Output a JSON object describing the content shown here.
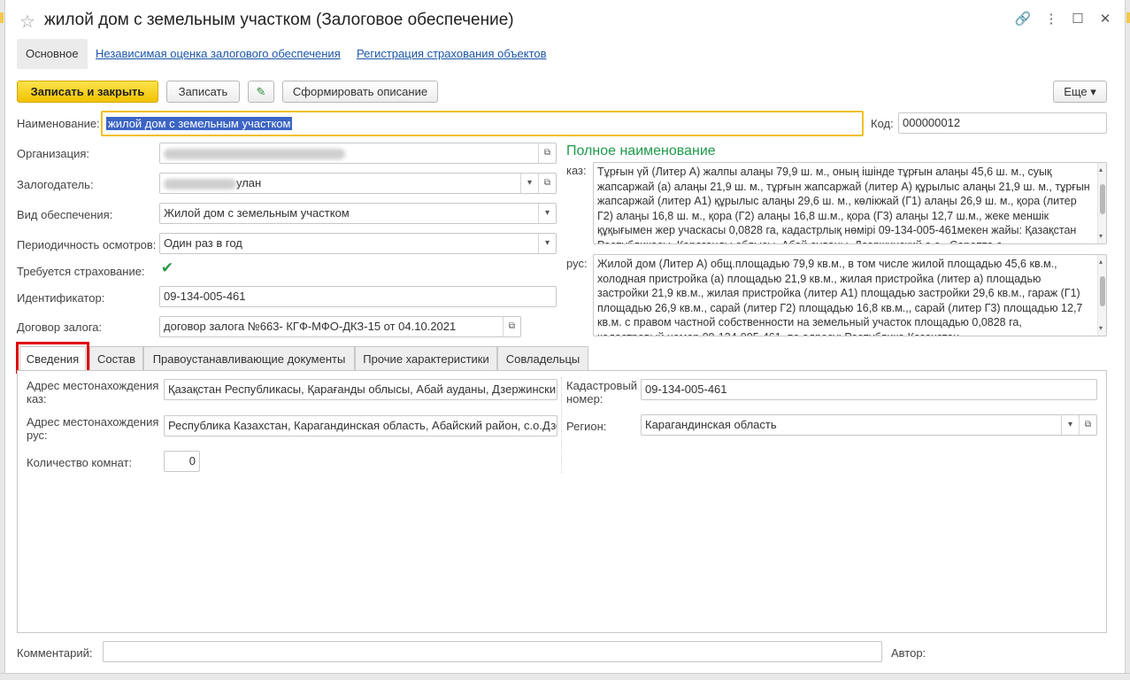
{
  "window": {
    "title": "жилой дом с земельным участком (Залоговое обеспечение)",
    "star": "☆",
    "link_icon": "🔗",
    "more_icon": "⋮",
    "maximize_icon": "☐",
    "close_icon": "✕"
  },
  "nav": {
    "main": "Основное",
    "appraisal": "Независимая оценка залогового обеспечения",
    "insurance": "Регистрация страхования объектов"
  },
  "toolbar": {
    "save_close": "Записать и закрыть",
    "save": "Записать",
    "edit_icon": "✎",
    "generate": "Сформировать описание",
    "more": "Еще ▾"
  },
  "form": {
    "name_label": "Наименование:",
    "name_value": "жилой дом с земельным участком",
    "code_label": "Код:",
    "code_value": "000000012",
    "org_label": "Организация:",
    "pledger_label": "Залогодатель:",
    "pledger_suffix": "улан",
    "type_label": "Вид обеспечения:",
    "type_value": "Жилой дом с земельным участком",
    "period_label": "Периодичность осмотров:",
    "period_value": "Один раз в год",
    "insurance_label": "Требуется страхование:",
    "insurance_check": "✔",
    "id_label": "Идентификатор:",
    "id_value": "09-134-005-461",
    "contract_label": "Договор залога:",
    "contract_value": "договор залога №663- КГФ-МФО-ДКЗ-15  от 04.10.2021"
  },
  "full_name": {
    "title": "Полное наименование",
    "kaz_label": "каз:",
    "kaz_text": "Тұрғын үй (Литер А) жалпы алаңы 79,9 ш. м., оның ішінде тұрғын алаңы 45,6 ш. м., суық жапсаржай (а) алаңы 21,9 ш. м., тұрғын жапсаржай (литер А) құрылыс алаңы 21,9 ш. м., тұрғын жапсаржай (литер А1) құрылыс алаңы 29,6 ш. м., көлікжай (Г1) алаңы 26,9 ш. м., қора (литер Г2) алаңы 16,8 ш. м., қора (Г2) алаңы 16,8 ш.м., қора (Г3) алаңы 12,7 ш.м., жеке меншік құқығымен жер учаскасы 0,0828 га,  кадастрлық нөмірі 09-134-005-461мекен жайы: Қазақстан Республикасы, Қарағанды облысы, Абай ауданы, Дзержинский а.о., Сарепта а.",
    "rus_label": "рус:",
    "rus_text": "Жилой дом (Литер А) общ.площадью 79,9 кв.м., в том числе жилой площадью 45,6 кв.м., холодная пристройка (а)  площадью 21,9 кв.м., жилая пристройка (литер а) площадью застройки 21,9 кв.м., жилая пристройка (литер А1) площадью застройки 29,6 кв.м., гараж (Г1) площадью  26,9 кв.м., сарай (литер Г2)  площадью 16,8 кв.м.,, сарай (литер Г3) площадью 12,7 кв.м. с правом частной собственности на земельный участок площадью 0,0828 га, кадастровый номер 09-134-005-461, по адресу: Республика Казахстан"
  },
  "tabs": [
    "Сведения",
    "Состав",
    "Правоустанавливающие документы",
    "Прочие характеристики",
    "Совладельцы"
  ],
  "details": {
    "addr_kaz_label": "Адрес местонахождения каз:",
    "addr_kaz_value": "Қазақстан Республикасы, Қарағанды облысы, Абай ауданы, Дзержинский",
    "addr_rus_label": "Адрес местонахождения рус:",
    "addr_rus_value": "Республика Казахстан, Карагандинская область, Абайский район, с.о.Дзе",
    "rooms_label": "Количество комнат:",
    "rooms_value": "0",
    "cadastre_label": "Кадастровый номер:",
    "cadastre_value": "09-134-005-461",
    "region_label": "Регион:",
    "region_value": "Карагандинская область"
  },
  "footer": {
    "comment_label": "Комментарий:",
    "author_label": "Автор:"
  },
  "icons": {
    "open": "⧉",
    "dropdown": "▾",
    "scroll_up": "▴",
    "scroll_down": "▾"
  },
  "colors": {
    "primary_button": "#f2c200",
    "link": "#1a56a6",
    "section_title": "#1f9a4a",
    "highlight_frame": "#e00000",
    "focus_border": "#f0c020"
  }
}
